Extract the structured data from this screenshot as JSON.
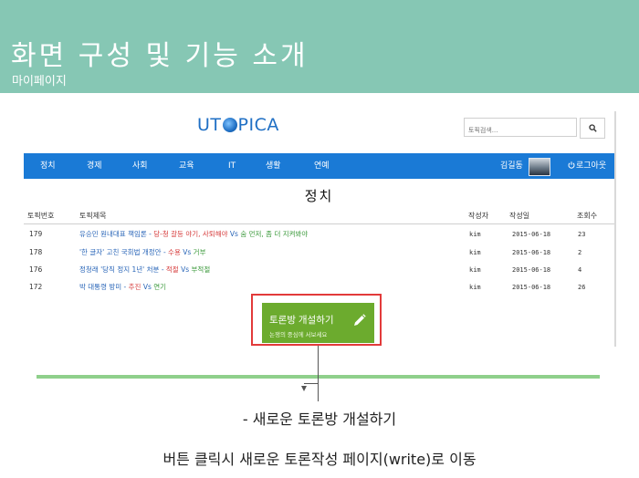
{
  "slide": {
    "title": "화면 구성 및 기능 소개",
    "subtitle": "마이페이지",
    "caption_1": "- 새로운 토론방 개설하기",
    "caption_2": "버튼 클릭시 새로운 토론작성 페이지(write)로 이동"
  },
  "site": {
    "logo_pre": "UT",
    "logo_post": "PICA",
    "search": {
      "placeholder": "토픽검색..."
    },
    "nav": [
      "정치",
      "경제",
      "사회",
      "교육",
      "IT",
      "생활",
      "연예"
    ],
    "user": {
      "name": "김길동",
      "logout": "로그아웃"
    }
  },
  "board": {
    "title": "정치",
    "headers": {
      "id": "토픽번호",
      "title": "토픽제목",
      "author": "작성자",
      "date": "작성일",
      "views": "조회수"
    },
    "rows": [
      {
        "id": "179",
        "title_main": "유승민 원내대표 책임론 - ",
        "pro": "당-청 갈등 야기, 사퇴해야",
        "vs": " Vs ",
        "con": "숨 먼저, 좀 더 지켜봐야",
        "author": "kim",
        "date": "2015-06-18",
        "views": "23"
      },
      {
        "id": "178",
        "title_main": "'한 글자' 고친 국회법 개정안 - ",
        "pro": "수용",
        "vs": " Vs ",
        "con": "거부",
        "author": "kim",
        "date": "2015-06-18",
        "views": "2"
      },
      {
        "id": "176",
        "title_main": "정청래 '당직 정지 1년' 처분 - ",
        "pro": "적절",
        "vs": " Vs ",
        "con": "부적절",
        "author": "kim",
        "date": "2015-06-18",
        "views": "4"
      },
      {
        "id": "172",
        "title_main": "박 대통령 방미 - ",
        "pro": "추진",
        "vs": " Vs ",
        "con": "연기",
        "author": "kim",
        "date": "2015-06-18",
        "views": "26"
      }
    ],
    "create_button": {
      "label": "토론방 개설하기",
      "sub": "논쟁의 중심에 서보세요"
    }
  },
  "colors": {
    "header_band": "#86c7b4",
    "navbar": "#1a7ad6",
    "logo": "#1f6fc4",
    "create_button": "#6cab2e",
    "highlight": "#e23a3a",
    "green_line": "#8fd08b",
    "pro_text": "#d63a3a",
    "con_text": "#3c9a3c"
  },
  "icons": {
    "search": "search-icon",
    "power": "power-icon",
    "pencil": "pencil-icon",
    "globe": "globe-icon"
  }
}
